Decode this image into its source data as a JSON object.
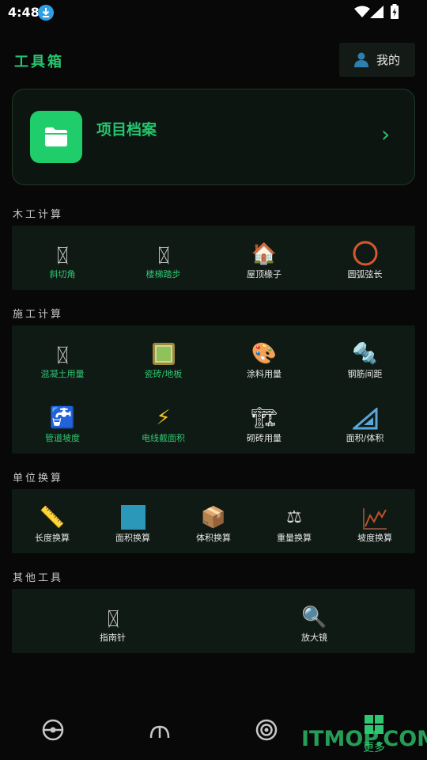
{
  "status_bar": {
    "time": "4:48"
  },
  "header": {
    "title": "工具箱",
    "mine_label": "我的"
  },
  "project_card": {
    "title": "项目档案",
    "chevron": "›"
  },
  "sections": [
    {
      "title": "木工计算",
      "tiles": [
        {
          "label": "斜切角",
          "icon": "placeholder",
          "label_color": "green"
        },
        {
          "label": "楼梯踏步",
          "icon": "placeholder",
          "label_color": "green"
        },
        {
          "label": "屋顶椽子",
          "icon": "house-icon",
          "glyph": "🏠",
          "label_color": "white"
        },
        {
          "label": "圆弧弦长",
          "icon": "circle-icon",
          "label_color": "white"
        }
      ]
    },
    {
      "title": "施工计算",
      "tiles": [
        {
          "label": "混凝土用量",
          "icon": "placeholder",
          "label_color": "green"
        },
        {
          "label": "瓷砖/地板",
          "icon": "tile-icon",
          "glyph": "🔲",
          "label_color": "green"
        },
        {
          "label": "涂料用量",
          "icon": "palette-icon",
          "glyph": "🎨",
          "label_color": "white"
        },
        {
          "label": "钢筋间距",
          "icon": "rebar-icon",
          "glyph": "🔩",
          "label_color": "white"
        },
        {
          "label": "管道坡度",
          "icon": "faucet-icon",
          "glyph": "🚰",
          "label_color": "green"
        },
        {
          "label": "电线截面积",
          "icon": "lightning-icon",
          "glyph": "⚡",
          "label_color": "green"
        },
        {
          "label": "砌砖用量",
          "icon": "crane-icon",
          "glyph": "🏗",
          "label_color": "white"
        },
        {
          "label": "面积/体积",
          "icon": "set-square-icon",
          "glyph": "📐",
          "label_color": "white"
        }
      ]
    },
    {
      "title": "单位换算",
      "tiles": [
        {
          "label": "长度换算",
          "icon": "ruler-icon",
          "glyph": "📏",
          "label_color": "white"
        },
        {
          "label": "面积换算",
          "icon": "square-icon",
          "label_color": "white"
        },
        {
          "label": "体积换算",
          "icon": "package-icon",
          "glyph": "📦",
          "label_color": "white"
        },
        {
          "label": "重量换算",
          "icon": "scale-icon",
          "glyph": "⚖",
          "label_color": "white"
        },
        {
          "label": "坡度换算",
          "icon": "chart-icon",
          "glyph": "📈",
          "label_color": "white"
        }
      ]
    },
    {
      "title": "其他工具",
      "tiles": [
        {
          "label": "指南针",
          "icon": "placeholder",
          "label_color": "white"
        },
        {
          "label": "放大镜",
          "icon": "magnifier-icon",
          "glyph": "🔍",
          "label_color": "white"
        }
      ]
    }
  ],
  "bottom_nav": {
    "more_label": "更多"
  },
  "watermark": "ITMOP.COM",
  "colors": {
    "accent": "#26c46f",
    "background": "#070807",
    "panel": "#0f1a14",
    "tile_green": "#1fce6a"
  }
}
